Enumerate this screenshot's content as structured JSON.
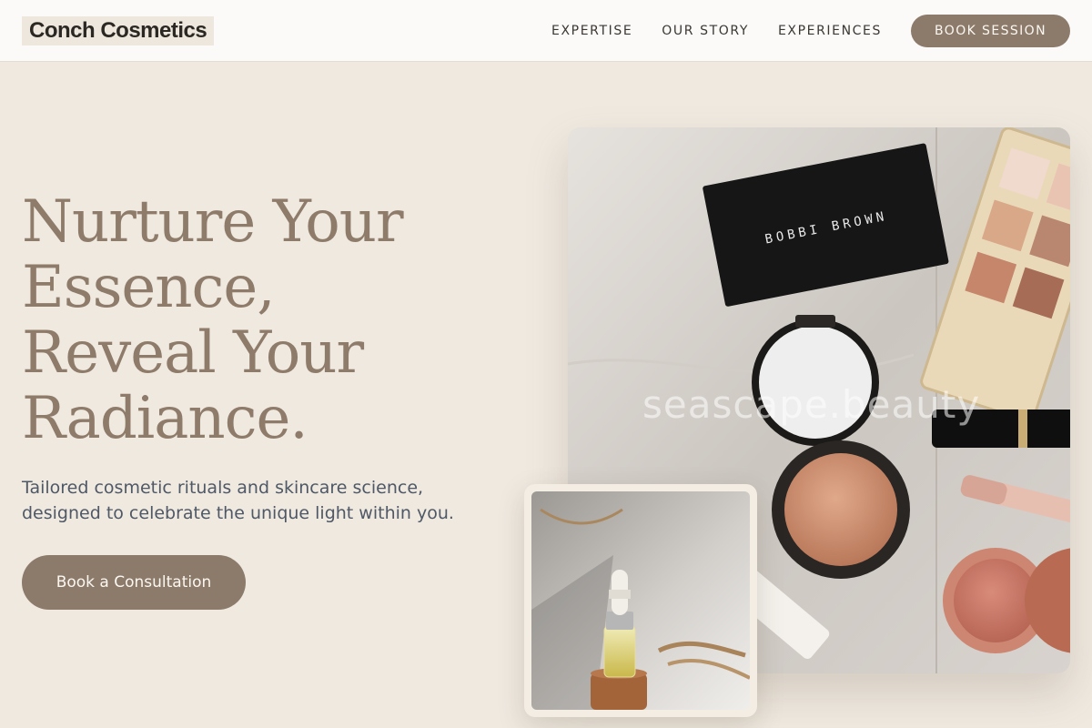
{
  "brand": {
    "name": "Conch Cosmetics"
  },
  "nav": {
    "items": [
      "EXPERTISE",
      "OUR STORY",
      "EXPERIENCES"
    ],
    "cta": "BOOK SESSION"
  },
  "hero": {
    "headline_lines": [
      "Nurture Your",
      "Essence,",
      "Reveal Your",
      "Radiance."
    ],
    "subtext_lines": [
      "Tailored cosmetic rituals and skincare science,",
      "designed to celebrate the unique light within you."
    ],
    "cta": "Book a Consultation"
  },
  "images": {
    "main": {
      "compact_brand": "BOBBI BROWN",
      "watermark": "seascape.beauty"
    }
  },
  "colors": {
    "background": "#efe9e0",
    "accent": "#8c7b6b",
    "headline": "#8e7b6a",
    "body_text": "#4f5866"
  }
}
